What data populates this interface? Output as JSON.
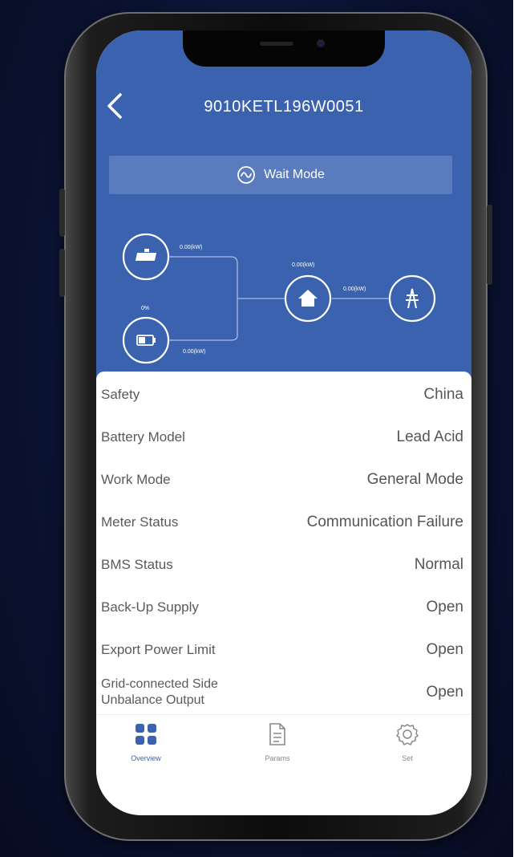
{
  "header": {
    "title": "9010KETL196W0051",
    "back_icon": "chevron-left-icon"
  },
  "mode": {
    "label": "Wait Mode",
    "icon": "wave-circle-icon"
  },
  "flow": {
    "pv_power": "0.00(kW)",
    "battery_label": "0%",
    "battery_power": "0.00(kW)",
    "load_power": "0.00(kW)",
    "grid_power": "0.00(kW)"
  },
  "details": [
    {
      "label": "Safety",
      "value": "China"
    },
    {
      "label": "Battery Model",
      "value": "Lead Acid"
    },
    {
      "label": "Work Mode",
      "value": "General Mode"
    },
    {
      "label": "Meter Status",
      "value": "Communication Failure"
    },
    {
      "label": "BMS Status",
      "value": "Normal"
    },
    {
      "label": "Back-Up Supply",
      "value": "Open"
    },
    {
      "label": "Export Power Limit",
      "value": "Open"
    },
    {
      "label_line1": "Grid-connected Side",
      "label_line2": "Unbalance Output",
      "value": "Open"
    }
  ],
  "tabs": [
    {
      "label": "Overview",
      "icon": "grid-icon",
      "active": true
    },
    {
      "label": "Params",
      "icon": "document-icon",
      "active": false
    },
    {
      "label": "Set",
      "icon": "gear-icon",
      "active": false
    }
  ],
  "colors": {
    "header_blue": "#3a62ae",
    "mode_bar": "#5a7bbd",
    "accent": "#3a62ae",
    "background": "#0b1333"
  }
}
